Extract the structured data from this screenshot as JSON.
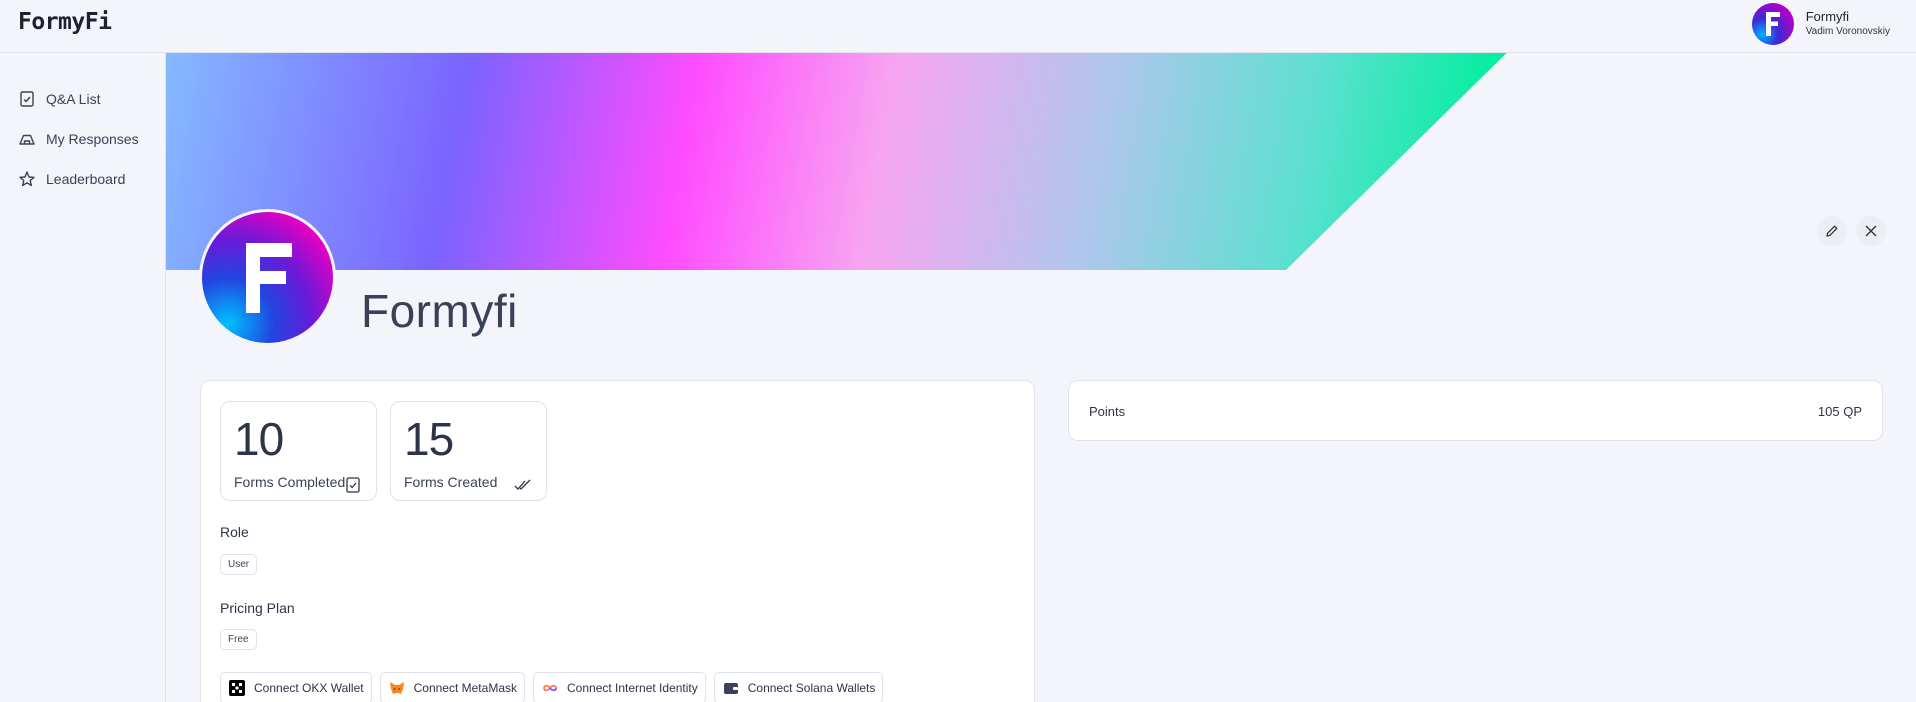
{
  "header": {
    "logo": "FormyFi",
    "user_name": "Formyfi",
    "user_sub": "Vadim Voronovskiy"
  },
  "sidebar": {
    "items": [
      {
        "label": "Q&A List",
        "icon": "checklist-icon"
      },
      {
        "label": "My Responses",
        "icon": "tray-icon"
      },
      {
        "label": "Leaderboard",
        "icon": "star-icon"
      }
    ]
  },
  "profile": {
    "name": "Formyfi"
  },
  "stats": [
    {
      "value": "10",
      "label": "Forms Completed",
      "icon": "check-document-icon"
    },
    {
      "value": "15",
      "label": "Forms Created",
      "icon": "double-check-icon"
    }
  ],
  "role": {
    "label": "Role",
    "value": "User"
  },
  "plan": {
    "label": "Pricing Plan",
    "value": "Free"
  },
  "wallets": [
    {
      "label": "Connect OKX Wallet",
      "icon": "okx-icon"
    },
    {
      "label": "Connect MetaMask",
      "icon": "metamask-fox-icon"
    },
    {
      "label": "Connect Internet Identity",
      "icon": "infinity-icon"
    },
    {
      "label": "Connect Solana Wallets",
      "icon": "wallet-icon"
    }
  ],
  "points": {
    "label": "Points",
    "value": "105 QP"
  },
  "colors": {
    "background": "#f4f5fb",
    "text": "#2e3448",
    "border": "#e1e3ec"
  }
}
